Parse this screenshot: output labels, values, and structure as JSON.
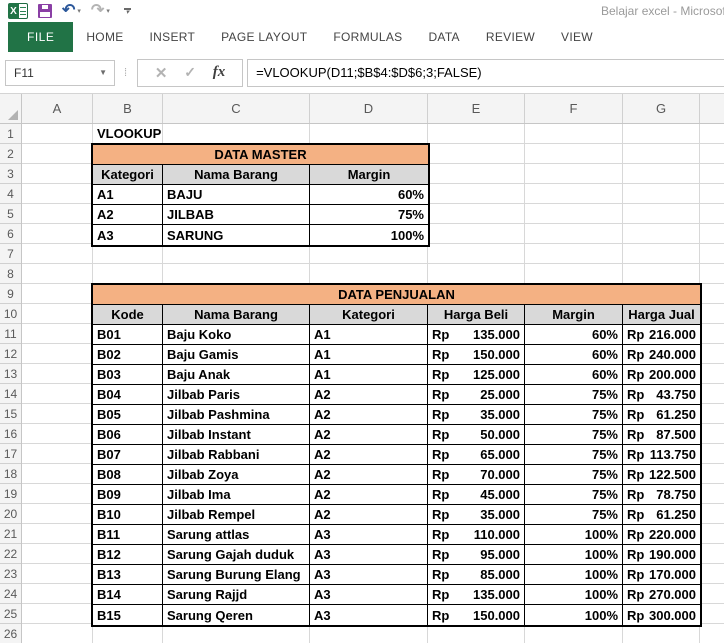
{
  "colors": {
    "file-green": "#217346",
    "save-purple": "#8A3FA5",
    "undo-blue": "#2B579A",
    "table-accent": "#F4B183",
    "header-gray": "#D9D9D9"
  },
  "window": {
    "title": "Belajar excel - Microsof"
  },
  "ribbon": {
    "file_tab": "FILE",
    "tabs": [
      "HOME",
      "INSERT",
      "PAGE LAYOUT",
      "FORMULAS",
      "DATA",
      "REVIEW",
      "VIEW"
    ]
  },
  "formula_bar": {
    "name_box": "F11",
    "cancel_glyph": "✕",
    "enter_glyph": "✓",
    "fx_label": "fx",
    "formula": "=VLOOKUP(D11;$B$4:$D$6;3;FALSE)"
  },
  "sheet": {
    "columns": [
      "A",
      "B",
      "C",
      "D",
      "E",
      "F",
      "G"
    ],
    "rows": [
      "1",
      "2",
      "3",
      "4",
      "5",
      "6",
      "7",
      "8",
      "9",
      "10",
      "11",
      "12",
      "13",
      "14",
      "15",
      "16",
      "17",
      "18",
      "19",
      "20",
      "21",
      "22",
      "23",
      "24",
      "25",
      "26"
    ],
    "b1": "VLOOKUP",
    "master": {
      "title": "DATA MASTER",
      "headers": [
        "Kategori",
        "Nama Barang",
        "Margin"
      ],
      "rows": [
        {
          "kategori": "A1",
          "nama": "BAJU",
          "margin": "60%"
        },
        {
          "kategori": "A2",
          "nama": "JILBAB",
          "margin": "75%"
        },
        {
          "kategori": "A3",
          "nama": "SARUNG",
          "margin": "100%"
        }
      ]
    },
    "penjualan": {
      "title": "DATA PENJUALAN",
      "headers": [
        "Kode",
        "Nama Barang",
        "Kategori",
        "Harga Beli",
        "Margin",
        "Harga Jual"
      ],
      "currency": "Rp",
      "rows": [
        {
          "kode": "B01",
          "nama": "Baju Koko",
          "kategori": "A1",
          "beli": "135.000",
          "margin": "60%",
          "jual": "216.000"
        },
        {
          "kode": "B02",
          "nama": "Baju Gamis",
          "kategori": "A1",
          "beli": "150.000",
          "margin": "60%",
          "jual": "240.000"
        },
        {
          "kode": "B03",
          "nama": "Baju Anak",
          "kategori": "A1",
          "beli": "125.000",
          "margin": "60%",
          "jual": "200.000"
        },
        {
          "kode": "B04",
          "nama": "Jilbab Paris",
          "kategori": "A2",
          "beli": "25.000",
          "margin": "75%",
          "jual": "43.750"
        },
        {
          "kode": "B05",
          "nama": "Jilbab Pashmina",
          "kategori": "A2",
          "beli": "35.000",
          "margin": "75%",
          "jual": "61.250"
        },
        {
          "kode": "B06",
          "nama": "Jilbab Instant",
          "kategori": "A2",
          "beli": "50.000",
          "margin": "75%",
          "jual": "87.500"
        },
        {
          "kode": "B07",
          "nama": "Jilbab Rabbani",
          "kategori": "A2",
          "beli": "65.000",
          "margin": "75%",
          "jual": "113.750"
        },
        {
          "kode": "B08",
          "nama": "Jilbab Zoya",
          "kategori": "A2",
          "beli": "70.000",
          "margin": "75%",
          "jual": "122.500"
        },
        {
          "kode": "B09",
          "nama": "Jilbab Ima",
          "kategori": "A2",
          "beli": "45.000",
          "margin": "75%",
          "jual": "78.750"
        },
        {
          "kode": "B10",
          "nama": "Jilbab Rempel",
          "kategori": "A2",
          "beli": "35.000",
          "margin": "75%",
          "jual": "61.250"
        },
        {
          "kode": "B11",
          "nama": "Sarung attlas",
          "kategori": "A3",
          "beli": "110.000",
          "margin": "100%",
          "jual": "220.000"
        },
        {
          "kode": "B12",
          "nama": "Sarung Gajah duduk",
          "kategori": "A3",
          "beli": "95.000",
          "margin": "100%",
          "jual": "190.000"
        },
        {
          "kode": "B13",
          "nama": "Sarung Burung Elang",
          "kategori": "A3",
          "beli": "85.000",
          "margin": "100%",
          "jual": "170.000"
        },
        {
          "kode": "B14",
          "nama": "Sarung Rajjd",
          "kategori": "A3",
          "beli": "135.000",
          "margin": "100%",
          "jual": "270.000"
        },
        {
          "kode": "B15",
          "nama": "Sarung Qeren",
          "kategori": "A3",
          "beli": "150.000",
          "margin": "100%",
          "jual": "300.000"
        }
      ]
    }
  }
}
